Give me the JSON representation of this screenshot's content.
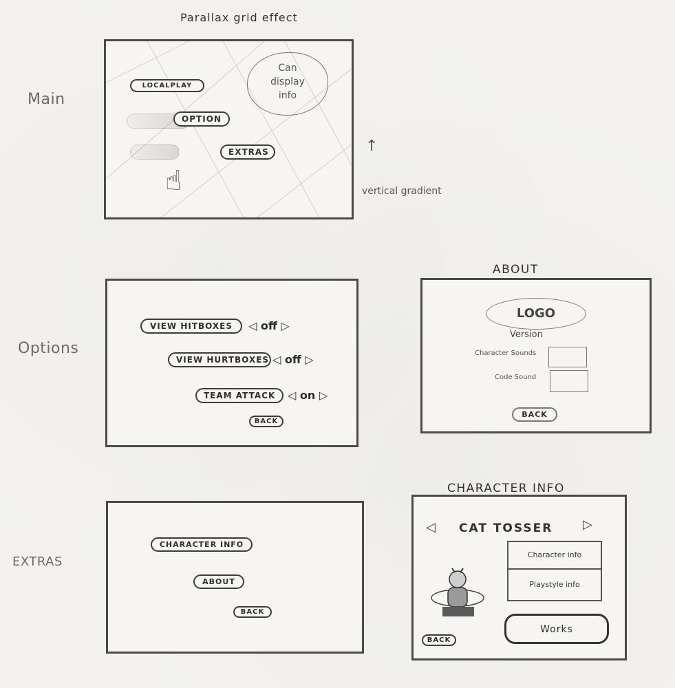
{
  "main": {
    "heading": "Parallax grid effect",
    "side_label": "Main",
    "buttons": [
      "LOCALPLAY",
      "OPTION",
      "EXTRAS"
    ],
    "info_bubble": [
      "Can",
      "display",
      "info"
    ],
    "gradient_note": "vertical gradient"
  },
  "options": {
    "side_label": "Options",
    "rows": [
      {
        "label": "VIEW HITBOXES",
        "value": "off"
      },
      {
        "label": "VIEW HURTBOXES",
        "value": "off"
      },
      {
        "label": "TEAM ATTACK",
        "value": "on"
      }
    ],
    "back": "BACK"
  },
  "about": {
    "title": "ABOUT",
    "logo": "LOGO",
    "version": "Version",
    "fields": [
      "Character Sounds",
      "Code Sound"
    ],
    "back": "BACK"
  },
  "extras": {
    "side_label": "EXTRAS",
    "buttons": [
      "CHARACTER INFO",
      "ABOUT",
      "BACK"
    ]
  },
  "character_info": {
    "title": "CHARACTER INFO",
    "name": "CAT TOSSER",
    "panels": [
      "Character info",
      "Playstyle info",
      "Works"
    ],
    "back": "BACK"
  }
}
